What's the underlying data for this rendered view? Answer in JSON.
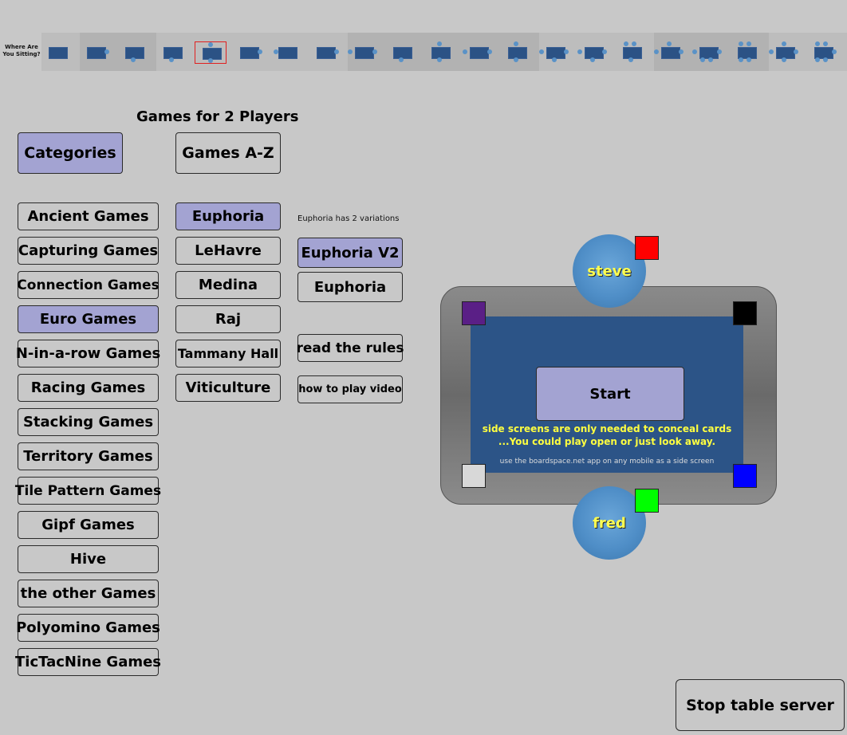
{
  "seat_picker": {
    "label": "Where Are You Sitting?",
    "selected_index": 4
  },
  "title": "Games for 2 Players",
  "mode_buttons": {
    "categories": "Categories",
    "games_az": "Games A-Z"
  },
  "categories": [
    {
      "label": "Ancient Games",
      "selected": false
    },
    {
      "label": "Capturing Games",
      "selected": false
    },
    {
      "label": "Connection Games",
      "selected": false
    },
    {
      "label": "Euro Games",
      "selected": true
    },
    {
      "label": "N-in-a-row Games",
      "selected": false
    },
    {
      "label": "Racing Games",
      "selected": false
    },
    {
      "label": "Stacking Games",
      "selected": false
    },
    {
      "label": "Territory Games",
      "selected": false
    },
    {
      "label": "Tile Pattern Games",
      "selected": false
    },
    {
      "label": "Gipf Games",
      "selected": false
    },
    {
      "label": "Hive",
      "selected": false
    },
    {
      "label": "the other Games",
      "selected": false
    },
    {
      "label": "Polyomino Games",
      "selected": false
    },
    {
      "label": "TicTacNine Games",
      "selected": false
    }
  ],
  "games": [
    {
      "label": "Euphoria",
      "selected": true
    },
    {
      "label": "LeHavre",
      "selected": false
    },
    {
      "label": "Medina",
      "selected": false
    },
    {
      "label": "Raj",
      "selected": false
    },
    {
      "label": "Tammany Hall",
      "selected": false
    },
    {
      "label": "Viticulture",
      "selected": false
    }
  ],
  "variations": {
    "note": "Euphoria has 2 variations",
    "items": [
      {
        "label": "Euphoria V2",
        "selected": true
      },
      {
        "label": "Euphoria",
        "selected": false
      }
    ],
    "rules": "read the rules",
    "video": "how to play video"
  },
  "table": {
    "players": {
      "top": "steve",
      "bottom": "fred"
    },
    "start": "Start",
    "side_msg_1": "side screens are only needed to conceal cards",
    "side_msg_2": "...You could play open or just look away.",
    "app_msg": "use the boardspace.net app on any mobile as a side screen",
    "colors": {
      "red": "#ff0000",
      "green": "#00ff00",
      "purple": "#5a1f86",
      "black": "#000000",
      "white": "#d8d8d8",
      "blue": "#0000ff",
      "felt": "#2c5487"
    }
  },
  "stop_button": "Stop table server"
}
